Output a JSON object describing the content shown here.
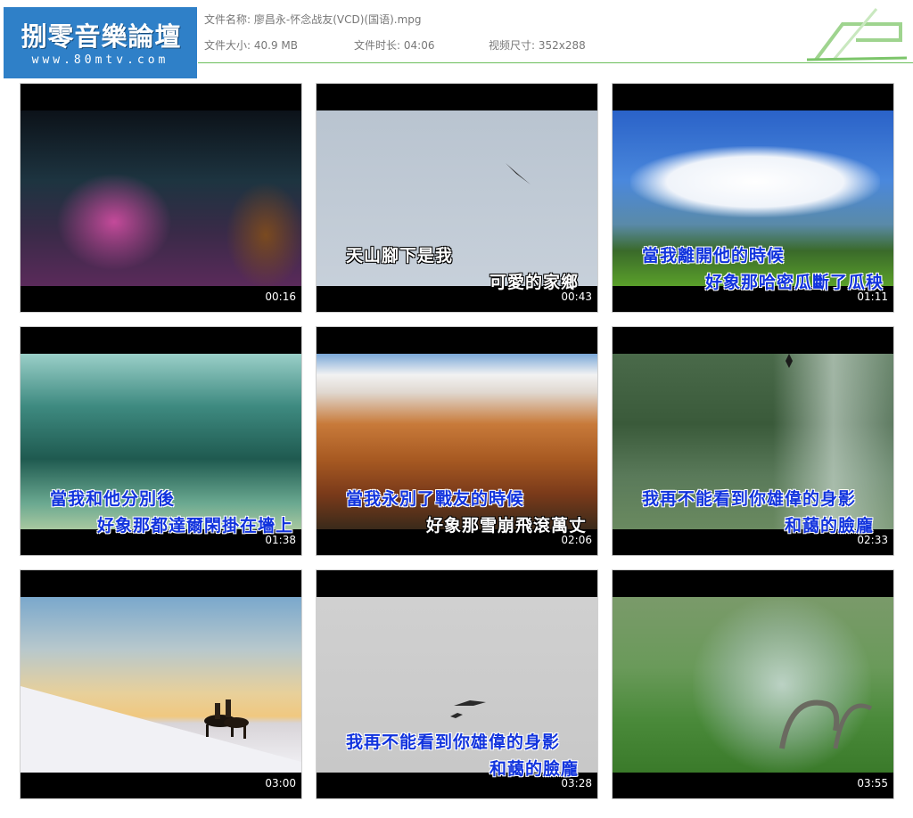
{
  "logo": {
    "title": "捌零音樂論壇",
    "url": "www.80mtv.com"
  },
  "file_info": {
    "name_label": "文件名称:",
    "name_value": "廖昌永-怀念战友(VCD)(国语).mpg",
    "size_label": "文件大小:",
    "size_value": "40.9 MB",
    "duration_label": "文件时长:",
    "duration_value": "04:06",
    "dimensions_label": "视频尺寸:",
    "dimensions_value": "352x288"
  },
  "thumbnails": [
    {
      "time": "00:16",
      "subtitles": []
    },
    {
      "time": "00:43",
      "subtitles": [
        {
          "text": "天山腳下是我",
          "color": "white"
        },
        {
          "text": "可愛的家鄉",
          "color": "white"
        }
      ]
    },
    {
      "time": "01:11",
      "subtitles": [
        {
          "text": "當我離開他的時候",
          "color": "blue"
        },
        {
          "text": "好象那哈密瓜斷了瓜秧",
          "color": "blue"
        }
      ]
    },
    {
      "time": "01:38",
      "subtitles": [
        {
          "text": "當我和他分別後",
          "color": "blue"
        },
        {
          "text": "好象那都達爾閑掛在墻上",
          "color": "blue"
        }
      ]
    },
    {
      "time": "02:06",
      "subtitles": [
        {
          "text": "當我永別了戰友的時候",
          "color": "blue"
        },
        {
          "text": "好象那雪崩飛滾萬丈",
          "color": "white"
        }
      ]
    },
    {
      "time": "02:33",
      "subtitles": [
        {
          "text": "我再不能看到你雄偉的身影",
          "color": "blue"
        },
        {
          "text": "和藹的臉龐",
          "color": "blue"
        }
      ]
    },
    {
      "time": "03:00",
      "subtitles": []
    },
    {
      "time": "03:28",
      "subtitles": [
        {
          "text": "我再不能看到你雄偉的身影",
          "color": "blue"
        },
        {
          "text": "和藹的臉龐",
          "color": "blue"
        }
      ]
    },
    {
      "time": "03:55",
      "subtitles": []
    }
  ]
}
